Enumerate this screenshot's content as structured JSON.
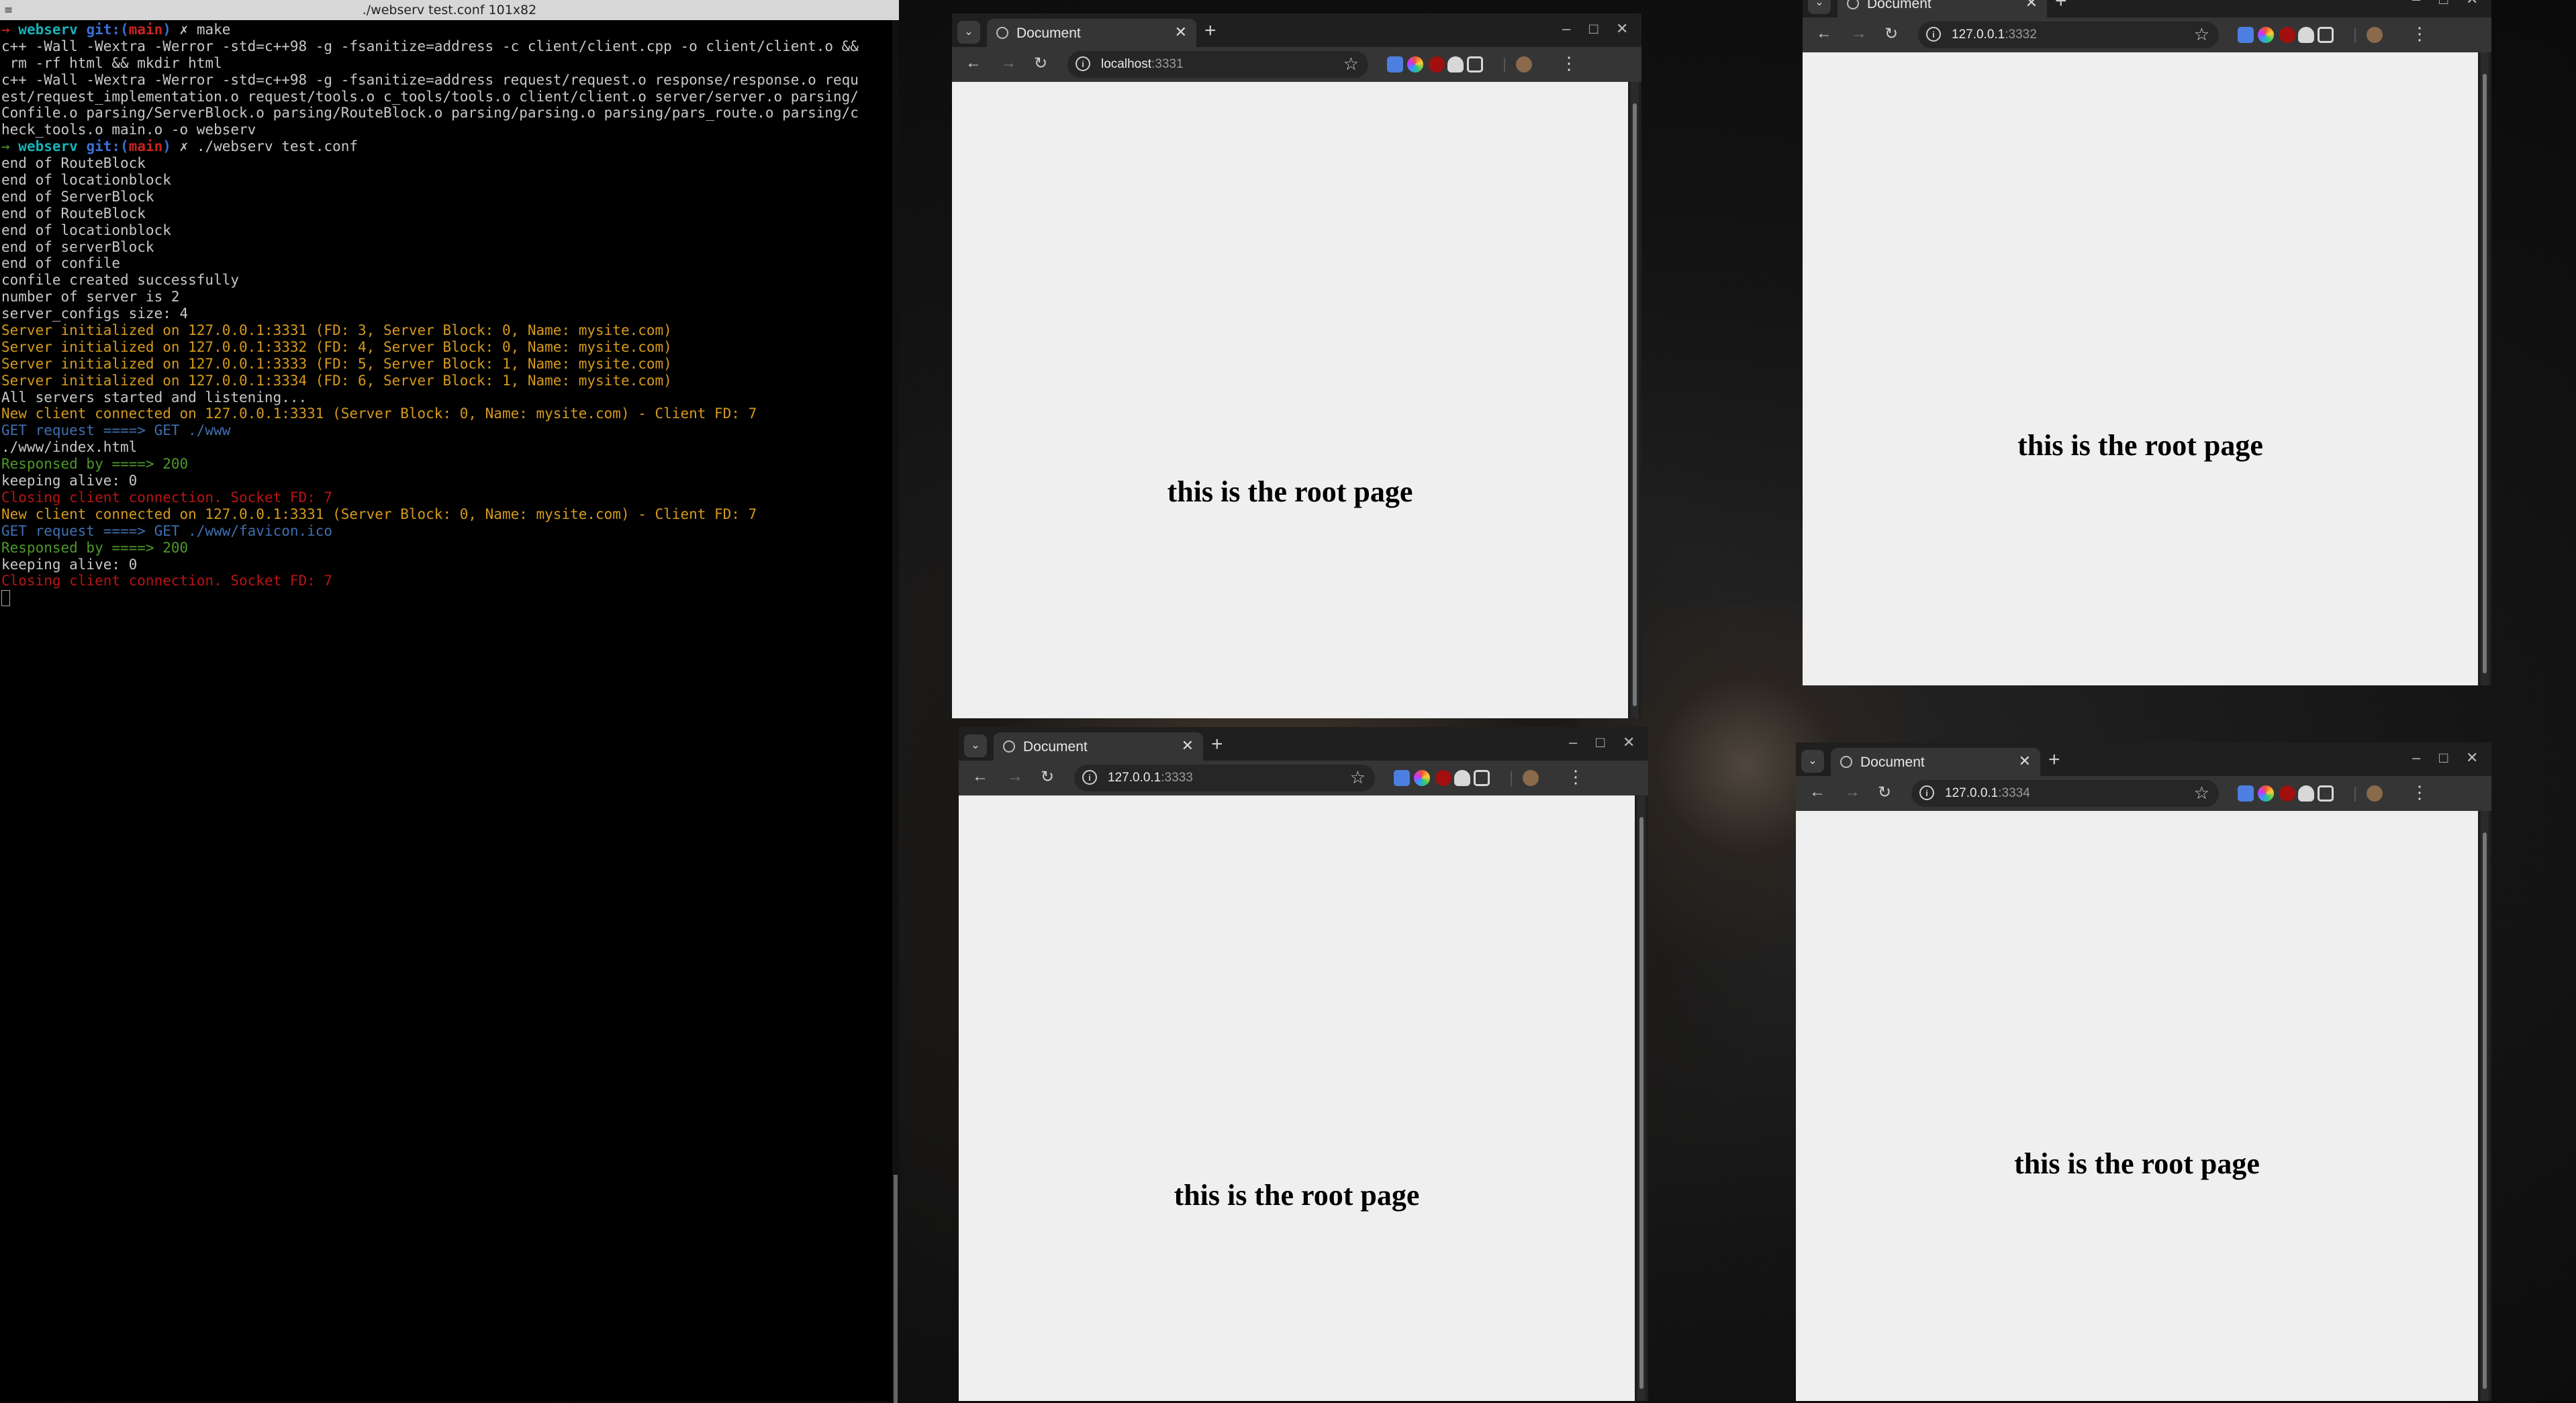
{
  "terminal": {
    "title": "./webserv test.conf 101x82",
    "lines": [
      [
        [
          "→ ",
          "c-red"
        ],
        [
          "webserv ",
          "c-cyan"
        ],
        [
          "git:(",
          "c-blue"
        ],
        [
          "main",
          "c-dred"
        ],
        [
          ")",
          "c-blue"
        ],
        [
          " ✗ make",
          ""
        ]
      ],
      [
        [
          "c++ -Wall -Wextra -Werror -std=c++98 -g -fsanitize=address -c client/client.cpp -o client/client.o &&",
          ""
        ]
      ],
      [
        [
          " rm -rf html && mkdir html",
          ""
        ]
      ],
      [
        [
          "c++ -Wall -Wextra -Werror -std=c++98 -g -fsanitize=address request/request.o response/response.o requ",
          ""
        ]
      ],
      [
        [
          "est/request_implementation.o request/tools.o c_tools/tools.o client/client.o server/server.o parsing/",
          ""
        ]
      ],
      [
        [
          "Confile.o parsing/ServerBlock.o parsing/RouteBlock.o parsing/parsing.o parsing/pars_route.o parsing/c",
          ""
        ]
      ],
      [
        [
          "heck_tools.o main.o -o webserv",
          ""
        ]
      ],
      [
        [
          "→ ",
          "c-green"
        ],
        [
          "webserv ",
          "c-cyan"
        ],
        [
          "git:(",
          "c-blue"
        ],
        [
          "main",
          "c-dred"
        ],
        [
          ")",
          "c-blue"
        ],
        [
          " ✗ ./webserv test.conf",
          ""
        ]
      ],
      [
        [
          "end of RouteBlock",
          ""
        ]
      ],
      [
        [
          "end of locationblock",
          ""
        ]
      ],
      [
        [
          "end of ServerBlock",
          ""
        ]
      ],
      [
        [
          "end of RouteBlock",
          ""
        ]
      ],
      [
        [
          "end of locationblock",
          ""
        ]
      ],
      [
        [
          "end of serverBlock",
          ""
        ]
      ],
      [
        [
          "end of confile",
          ""
        ]
      ],
      [
        [
          "confile created successfully",
          ""
        ]
      ],
      [
        [
          "number of server is 2",
          ""
        ]
      ],
      [
        [
          "server_configs size: 4",
          ""
        ]
      ],
      [
        [
          "Server initialized on 127.0.0.1:3331 (FD: 3, Server Block: 0, Name: mysite.com)",
          "c-orange"
        ]
      ],
      [
        [
          "Server initialized on 127.0.0.1:3332 (FD: 4, Server Block: 0, Name: mysite.com)",
          "c-orange"
        ]
      ],
      [
        [
          "Server initialized on 127.0.0.1:3333 (FD: 5, Server Block: 1, Name: mysite.com)",
          "c-orange"
        ]
      ],
      [
        [
          "Server initialized on 127.0.0.1:3334 (FD: 6, Server Block: 1, Name: mysite.com)",
          "c-orange"
        ]
      ],
      [
        [
          "All servers started and listening...",
          ""
        ]
      ],
      [
        [
          "New client connected on 127.0.0.1:3331 (Server Block: 0, Name: mysite.com) - Client FD: 7",
          "c-orange"
        ]
      ],
      [
        [
          "GET request ====> GET ./www",
          "c-steel"
        ]
      ],
      [
        [
          "./www/index.html",
          ""
        ]
      ],
      [
        [
          "Responsed by ====> 200",
          "c-green"
        ]
      ],
      [
        [
          "keeping alive: 0",
          ""
        ]
      ],
      [
        [
          "Closing client connection. Socket FD: 7",
          "c-errred"
        ]
      ],
      [
        [
          "New client connected on 127.0.0.1:3331 (Server Block: 0, Name: mysite.com) - Client FD: 7",
          "c-orange"
        ]
      ],
      [
        [
          "GET request ====> GET ./www/favicon.ico",
          "c-steel"
        ]
      ],
      [
        [
          "Responsed by ====> 200",
          "c-green"
        ]
      ],
      [
        [
          "keeping alive: 0",
          ""
        ]
      ],
      [
        [
          "Closing client connection. Socket FD: 7",
          "c-errred"
        ]
      ]
    ]
  },
  "browsers": [
    {
      "tab_title": "Document",
      "url_host": "localhost",
      "url_port": ":3331",
      "heading": "this is the root page"
    },
    {
      "tab_title": "Document",
      "url_host": "127.0.0.1",
      "url_port": ":3332",
      "heading": "this is the root page"
    },
    {
      "tab_title": "Document",
      "url_host": "127.0.0.1",
      "url_port": ":3333",
      "heading": "this is the root page"
    },
    {
      "tab_title": "Document",
      "url_host": "127.0.0.1",
      "url_port": ":3334",
      "heading": "this is the root page"
    }
  ],
  "icons": {
    "tab_list": "⌄",
    "close": "✕",
    "new_tab": "+",
    "minimize": "–",
    "maximize": "□",
    "back": "←",
    "forward": "→",
    "reload": "↻",
    "info": "i",
    "star": "☆",
    "menu": "⋮"
  }
}
